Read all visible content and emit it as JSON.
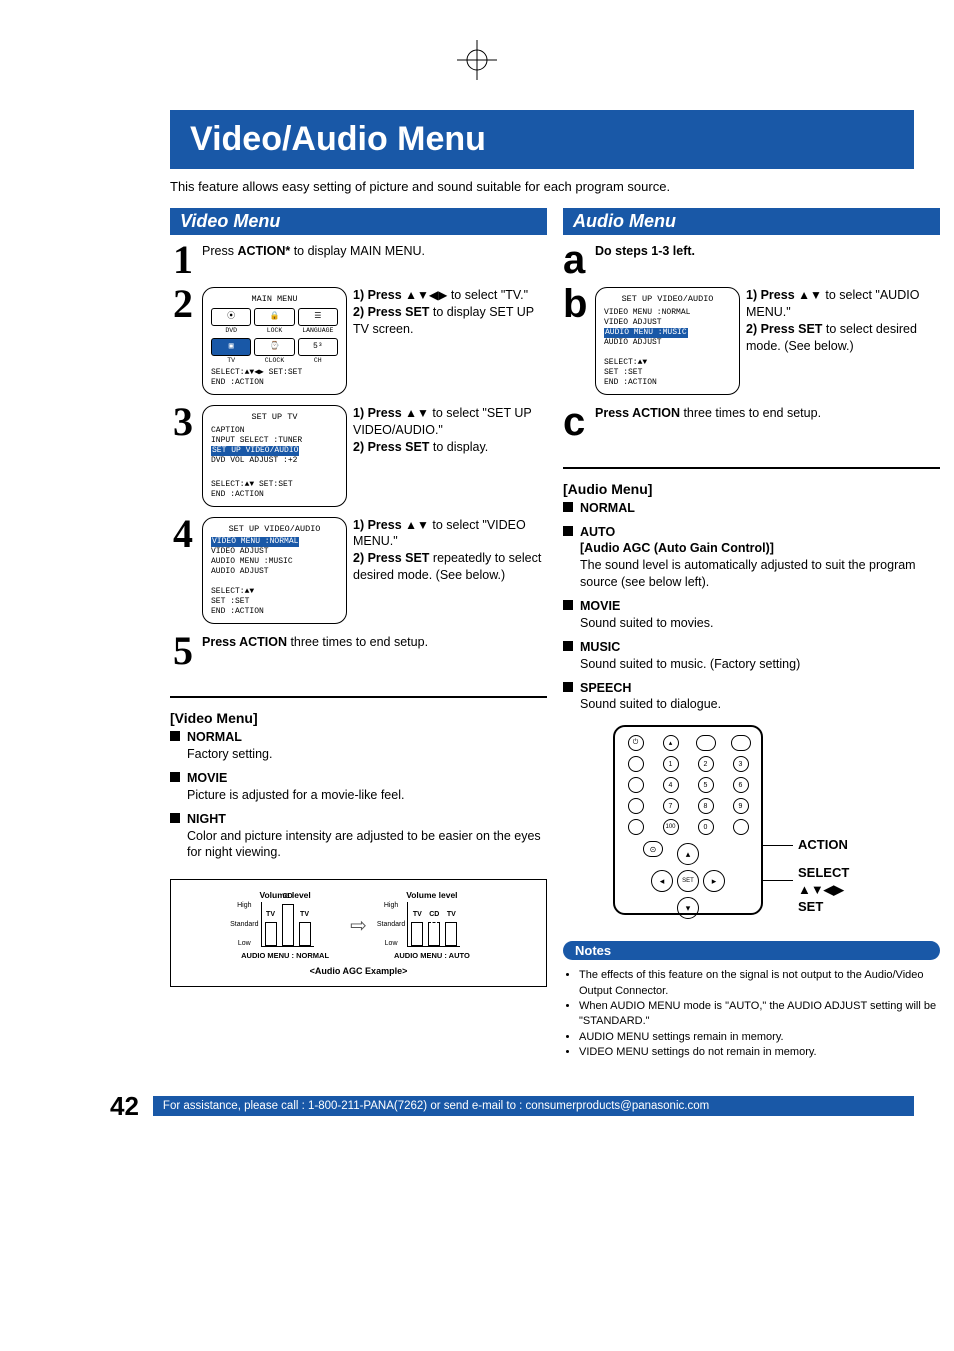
{
  "page": {
    "title": "Video/Audio Menu",
    "intro": "This feature allows easy setting of picture and sound suitable for each program source.",
    "page_number": "42",
    "footer": "For assistance, please call : 1-800-211-PANA(7262) or send e-mail to : consumerproducts@panasonic.com"
  },
  "video": {
    "heading": "Video Menu",
    "step1": {
      "num": "1",
      "text_before": "Press ",
      "bold": "ACTION*",
      "text_after": " to display MAIN MENU."
    },
    "step2": {
      "num": "2",
      "osd": {
        "title": "MAIN MENU",
        "icons": [
          "DVD",
          "LOCK",
          "LANGUAGE",
          "TV",
          "CLOCK",
          "CH"
        ],
        "foot1": "SELECT:▲▼◀▶   SET:SET",
        "foot2": "END    :ACTION"
      },
      "instr1_b": "1) Press ",
      "instr1_sym": "▲▼◀▶",
      "instr1_after": " to select \"TV.\"",
      "instr2_b": "2) Press SET",
      "instr2_after": " to display SET UP TV screen."
    },
    "step3": {
      "num": "3",
      "osd": {
        "title": "SET UP TV",
        "lines": [
          "CAPTION",
          "INPUT SELECT    :TUNER"
        ],
        "hl": "SET UP VIDEO/AUDIO",
        "lines2": [
          "DVD VOL ADJUST :+2"
        ],
        "foot1": "SELECT:▲▼     SET:SET",
        "foot2": "END    :ACTION"
      },
      "instr1_b": "1) Press ",
      "instr1_sym": "▲▼",
      "instr1_after": " to select \"SET UP VIDEO/AUDIO.\"",
      "instr2_b": "2) Press SET",
      "instr2_after": " to display."
    },
    "step4": {
      "num": "4",
      "osd": {
        "title": "SET UP VIDEO/AUDIO",
        "hl": "VIDEO MENU      :NORMAL",
        "lines": [
          "VIDEO ADJUST",
          "AUDIO MENU      :MUSIC",
          "AUDIO ADJUST"
        ],
        "foot1": "SELECT:▲▼",
        "foot2": "SET    :SET",
        "foot3": "END    :ACTION"
      },
      "instr1_b": "1) Press ",
      "instr1_sym": "▲▼",
      "instr1_after": " to select \"VIDEO MENU.\"",
      "instr2_b": "2) Press SET",
      "instr2_after": " repeatedly to select desired mode. (See below.)"
    },
    "step5": {
      "num": "5",
      "bold": "Press ACTION",
      "after": " three times to end setup."
    },
    "section_title": "[Video Menu]",
    "bullets": [
      {
        "label": "NORMAL",
        "desc": "Factory setting."
      },
      {
        "label": "MOVIE",
        "desc": "Picture is adjusted for a movie-like feel."
      },
      {
        "label": "NIGHT",
        "desc": "Color and picture intensity are adjusted to be easier on the eyes for night viewing."
      }
    ],
    "agc": {
      "vol_label": "Volume level",
      "y": [
        "High",
        "Standard",
        "Low"
      ],
      "bars": [
        "TV",
        "CD",
        "TV"
      ],
      "mode_left": "AUDIO MENU : NORMAL",
      "mode_right": "AUDIO MENU : AUTO",
      "caption": "<Audio AGC Example>"
    }
  },
  "audio": {
    "heading": "Audio Menu",
    "stepA": {
      "num": "a",
      "bold": "Do steps 1-3 left."
    },
    "stepB": {
      "num": "b",
      "osd": {
        "title": "SET UP VIDEO/AUDIO",
        "lines": [
          "VIDEO MENU      :NORMAL",
          "VIDEO ADJUST"
        ],
        "hl": "AUDIO MENU      :MUSIC",
        "lines2": [
          "AUDIO ADJUST"
        ],
        "foot1": "SELECT:▲▼",
        "foot2": "SET    :SET",
        "foot3": "END    :ACTION"
      },
      "instr1_b": "1) Press ",
      "instr1_sym": "▲▼",
      "instr1_after": " to select \"AUDIO MENU.\"",
      "instr2_b": "2) Press SET",
      "instr2_after": " to select desired mode. (See below.)"
    },
    "stepC": {
      "num": "c",
      "bold": "Press ACTION",
      "after": " three times to end setup."
    },
    "section_title": "[Audio Menu]",
    "bullets": [
      {
        "label": "NORMAL",
        "desc": ""
      },
      {
        "label": "AUTO",
        "sub": "[Audio AGC (Auto Gain Control)]",
        "desc": "The sound level is automatically adjusted to suit the program source (see below left)."
      },
      {
        "label": "MOVIE",
        "desc": "Sound suited to movies."
      },
      {
        "label": "MUSIC",
        "desc": "Sound suited to music. (Factory setting)"
      },
      {
        "label": "SPEECH",
        "desc": "Sound suited to dialogue."
      }
    ],
    "remote": {
      "callout_action": "ACTION",
      "callout_select": "SELECT",
      "callout_arrows": "▲▼◀▶",
      "callout_set": "SET",
      "keys": [
        "1",
        "2",
        "3",
        "4",
        "5",
        "6",
        "7",
        "8",
        "9",
        "100",
        "0"
      ]
    },
    "notes_label": "Notes",
    "notes": [
      "The effects of this feature on the signal is not output to the Audio/Video Output Connector.",
      "When AUDIO MENU mode is \"AUTO,\" the AUDIO ADJUST setting will be \"STANDARD.\"",
      "AUDIO MENU settings remain in memory.",
      "VIDEO MENU settings do not remain in memory."
    ]
  }
}
